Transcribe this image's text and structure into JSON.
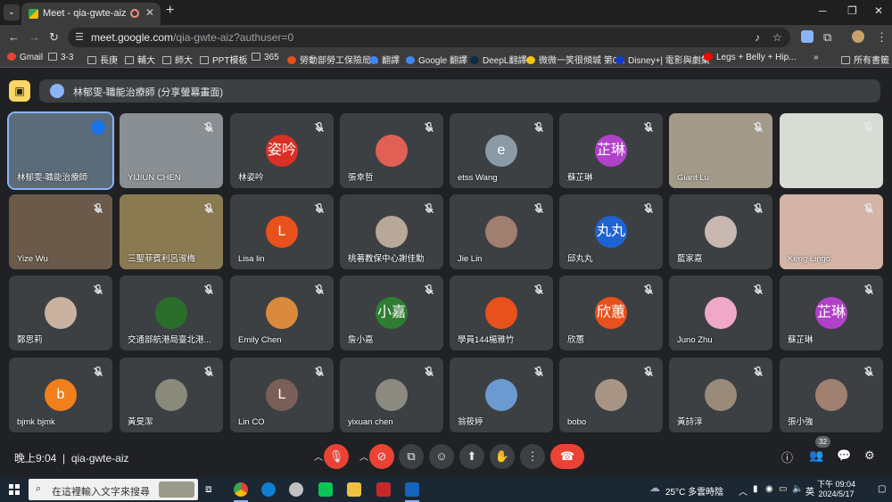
{
  "browser": {
    "tab_title": "Meet - qia-gwte-aiz",
    "url_host": "meet.google.com",
    "url_path": "/qia-gwte-aiz?authuser=0",
    "bookmarks": [
      "Gmail",
      "3-3",
      "長庚",
      "輔大",
      "師大",
      "PPT模板",
      "365",
      "勞動部勞工保險局...",
      "翻譯",
      "Google 翻譯",
      "DeepL翻譯",
      "微微一笑很傾城 第0...",
      "Disney+| 電影與劇集",
      "Legs + Belly + Hip...",
      "所有書籤"
    ]
  },
  "meet": {
    "presenting_text": "林郁雯-職能治療師 (分享螢幕畫面)",
    "time": "晚上9:04",
    "meeting_code": "qia-gwte-aiz",
    "participant_count": "32",
    "tiles": [
      {
        "name": "林郁雯-職能治療師",
        "initial": "",
        "color": "#5b6b7a"
      },
      {
        "name": "YIJIUN CHEN",
        "initial": "",
        "color": "#8a8f94"
      },
      {
        "name": "林姿吟",
        "initial": "姿吟",
        "color": "#d93025"
      },
      {
        "name": "張幸哲",
        "initial": "",
        "color": "#e06055"
      },
      {
        "name": "etss Wang",
        "initial": "e",
        "color": "#8a9aa6"
      },
      {
        "name": "蘇芷琳",
        "initial": "芷琳",
        "color": "#b241c9"
      },
      {
        "name": "Giant Lu",
        "initial": "",
        "color": "#a49a8a"
      },
      {
        "name": "",
        "initial": "",
        "color": "#d8dcd4"
      },
      {
        "name": "Yize Wu",
        "initial": "",
        "color": "#6b5a4a"
      },
      {
        "name": "三聖菲賓利呂淑梅",
        "initial": "",
        "color": "#8a7a52"
      },
      {
        "name": "Lisa lin",
        "initial": "L",
        "color": "#e8501c"
      },
      {
        "name": "桃著教保中心謝佳勳",
        "initial": "",
        "color": "#b8a89a"
      },
      {
        "name": "Jie Lin",
        "initial": "",
        "color": "#a07f70"
      },
      {
        "name": "邱丸丸",
        "initial": "丸丸",
        "color": "#1e63d4"
      },
      {
        "name": "藍家嘉",
        "initial": "",
        "color": "#c8b8b0"
      },
      {
        "name": "Keng Lingo",
        "initial": "",
        "color": "#d4b4a6"
      },
      {
        "name": "鄭思莉",
        "initial": "",
        "color": "#c9b2a0"
      },
      {
        "name": "交通部航港局臺北港...",
        "initial": "",
        "color": "#2b6e2b"
      },
      {
        "name": "Emily Chen",
        "initial": "",
        "color": "#d98a3c"
      },
      {
        "name": "詹小嘉",
        "initial": "小嘉",
        "color": "#2e7d32"
      },
      {
        "name": "學員144楊雅竹",
        "initial": "",
        "color": "#e8501c"
      },
      {
        "name": "欣蕙",
        "initial": "欣蕙",
        "color": "#e8501c"
      },
      {
        "name": "Juno Zhu",
        "initial": "",
        "color": "#f0a8c8"
      },
      {
        "name": "蘇芷琳",
        "initial": "芷琳",
        "color": "#b241c9"
      },
      {
        "name": "bjmk bjmk",
        "initial": "b",
        "color": "#f07f1c"
      },
      {
        "name": "黃旻潔",
        "initial": "",
        "color": "#8a8a7a"
      },
      {
        "name": "Lin CO",
        "initial": "L",
        "color": "#7b5e57"
      },
      {
        "name": "yixuan chen",
        "initial": "",
        "color": "#8a8a80"
      },
      {
        "name": "翁筱婷",
        "initial": "",
        "color": "#6a9ad0"
      },
      {
        "name": "bobo",
        "initial": "",
        "color": "#a89484"
      },
      {
        "name": "黃詩淳",
        "initial": "",
        "color": "#9a8a7a"
      },
      {
        "name": "張小強",
        "initial": "",
        "color": "#a08070"
      }
    ]
  },
  "taskbar": {
    "search_placeholder": "在這裡輸入文字來搜尋",
    "weather": "25°C 多雲時陰",
    "ime": "英",
    "time": "下午 09:04",
    "date": "2024/5/17"
  }
}
